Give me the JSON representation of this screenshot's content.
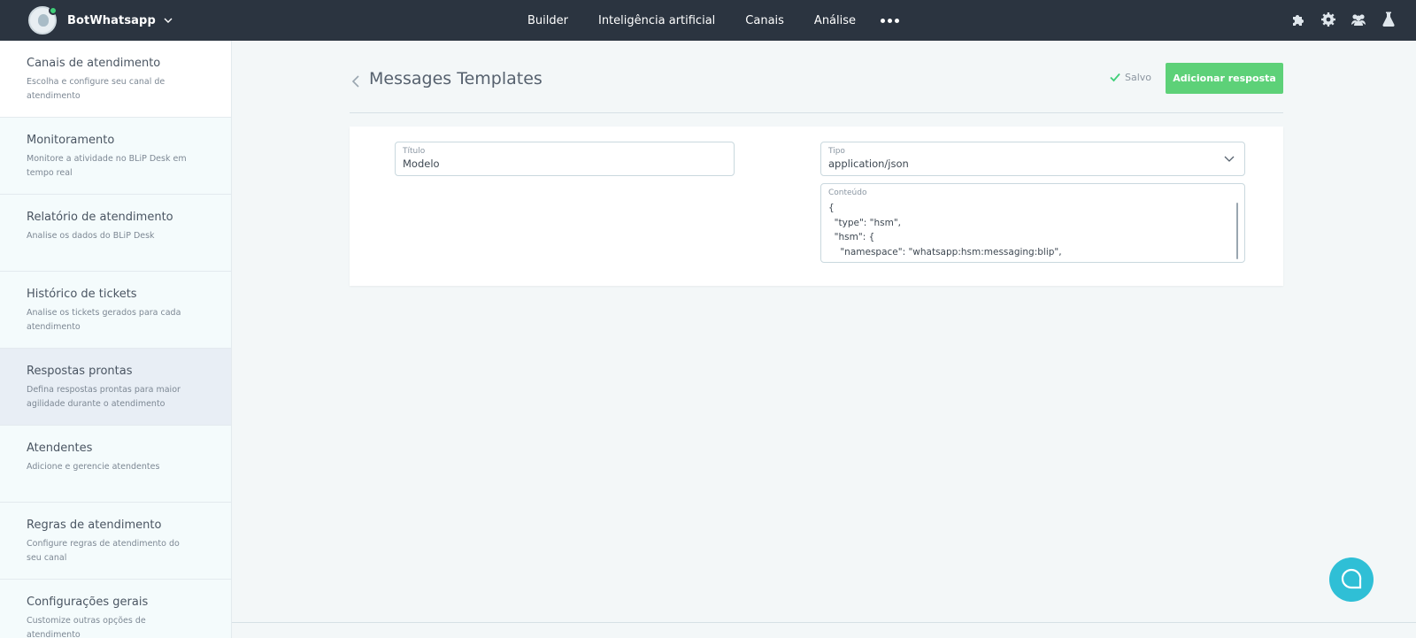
{
  "topbar": {
    "bot_name": "BotWhatsapp",
    "nav": [
      "Builder",
      "Inteligência artificial",
      "Canais",
      "Análise"
    ],
    "icons": [
      "puzzle-icon",
      "gear-icon",
      "team-icon",
      "flask-icon"
    ]
  },
  "sidebar": {
    "items": [
      {
        "title": "Canais de atendimento",
        "desc": "Escolha e configure seu canal de atendimento"
      },
      {
        "title": "Monitoramento",
        "desc": "Monitore a atividade no BLiP Desk em tempo real"
      },
      {
        "title": "Relatório de atendimento",
        "desc": "Analise os dados do BLiP Desk"
      },
      {
        "title": "Histórico de tickets",
        "desc": "Analise os tickets gerados para cada atendimento"
      },
      {
        "title": "Respostas prontas",
        "desc": "Defina respostas prontas para maior agilidade durante o atendimento"
      },
      {
        "title": "Atendentes",
        "desc": "Adicione e gerencie atendentes"
      },
      {
        "title": "Regras de atendimento",
        "desc": "Configure regras de atendimento do seu canal"
      },
      {
        "title": "Configurações gerais",
        "desc": "Customize outras opções de atendimento"
      }
    ]
  },
  "header": {
    "title": "Messages Templates",
    "saved_label": "Salvo",
    "add_button": "Adicionar resposta"
  },
  "form": {
    "titulo_label": "Título",
    "titulo_value": "Modelo",
    "tipo_label": "Tipo",
    "tipo_value": "application/json",
    "conteudo_label": "Conteúdo",
    "conteudo_value": "{\n  \"type\": \"hsm\",\n  \"hsm\": {\n    \"namespace\": \"whatsapp:hsm:messaging:blip\","
  },
  "colors": {
    "topbar": "#2b3440",
    "accent_green": "#5dd178",
    "chat_fab": "#2fbfd6"
  }
}
